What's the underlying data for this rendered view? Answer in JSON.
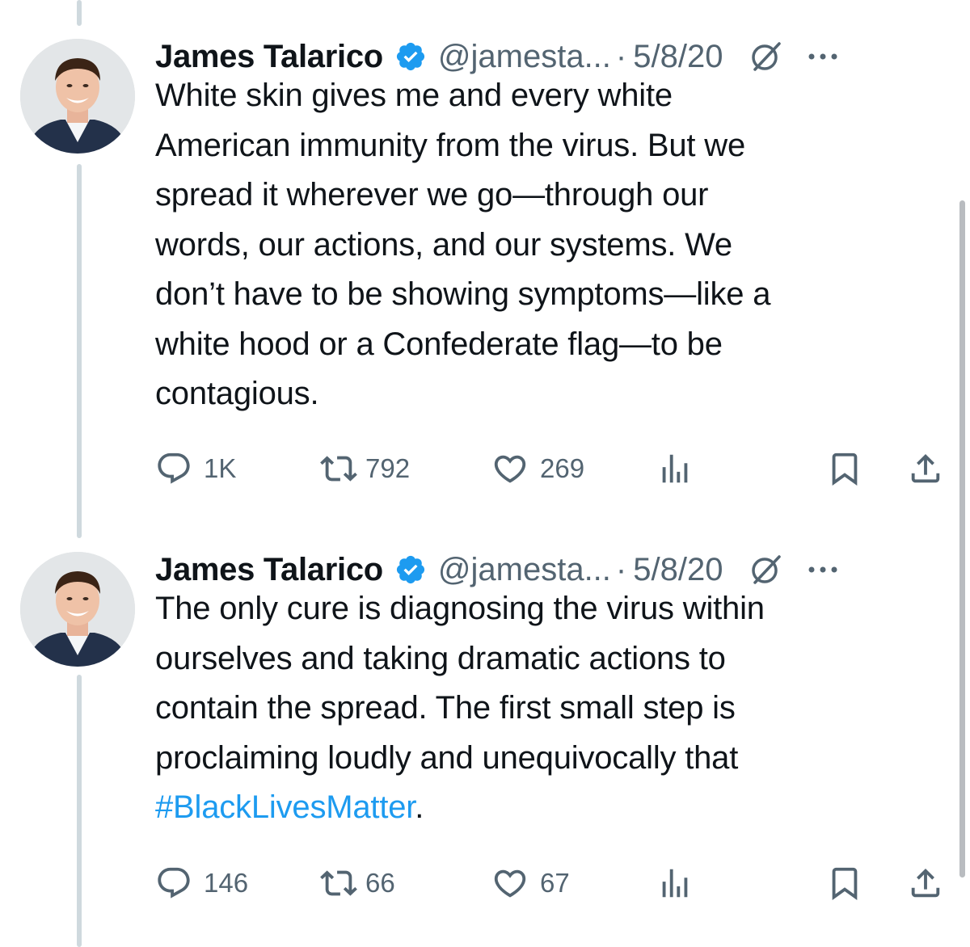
{
  "tweets": [
    {
      "author": {
        "name": "James Talarico",
        "handle": "@jamesta...",
        "verified": true
      },
      "separator": "·",
      "date": "5/8/20",
      "text_plain": "White skin gives me and every white American immunity from the virus. But we spread it wherever we go—through our words, our actions, and our systems. We don’t have to be showing symptoms—like a white hood or a Confederate flag—to be contagious.",
      "text_lines": [
        "White skin gives me and every white",
        "American immunity from the virus. But we",
        "spread it wherever we go—through our",
        "words, our actions, and our systems. We",
        "don’t have to be showing symptoms—like a",
        "white hood or a Confederate flag—to be",
        "contagious."
      ],
      "stats": {
        "replies": "1K",
        "reposts": "792",
        "likes": "269"
      }
    },
    {
      "author": {
        "name": "James Talarico",
        "handle": "@jamesta...",
        "verified": true
      },
      "separator": "·",
      "date": "5/8/20",
      "text_lines": [
        "The only cure is diagnosing the virus within",
        "ourselves and taking dramatic actions to",
        "contain the spread. The first small step is",
        "proclaiming loudly and unequivocally that"
      ],
      "hashtag": "#BlackLivesMatter",
      "hashtag_suffix": ".",
      "stats": {
        "replies": "146",
        "reposts": "66",
        "likes": "67"
      }
    }
  ],
  "colors": {
    "text": "#0f1419",
    "secondary": "#536471",
    "accent": "#1d9bf0",
    "verified_badge": "#1d9bf0",
    "thread_line": "#cfd9de"
  },
  "icons": {
    "reply": "reply-icon",
    "repost": "repost-icon",
    "like": "like-icon",
    "views": "views-icon",
    "bookmark": "bookmark-icon",
    "share": "share-icon",
    "grok": "grok-icon",
    "more": "more-icon",
    "verified": "verified-badge-icon"
  }
}
